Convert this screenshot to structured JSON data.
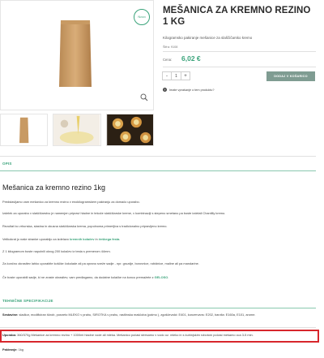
{
  "product": {
    "title": "MEŠANICA ZA KREMNO REZINO 1 KG",
    "subtitle": "Kilogramsko pakiranje mešanice za slaščičarsko kremo",
    "sku": "Šifra: 9108",
    "price_label": "Cena:",
    "price": "6,02 €",
    "quantity": "1",
    "minus": "-",
    "plus": "+",
    "add_to_cart": "DODAJ V KOŠARICO",
    "question": "Imate vprašanje o tem produktu?",
    "badge": "Novo"
  },
  "sections": {
    "desc_head": "OPIS",
    "desc_title": "Mešanica za kremno rezino 1kg",
    "p1": "Predstavljamo vam mešanico za kremno rezino v enokilogramskem pakiranju za domačo uporabo.",
    "p2": "Izdelek za uporabo v slaščičarstvu je namenjen pripravi hladne in tekoče slaščičarske kreme, v kombinaciji s stepeno smetano pa boste izdelali Chantilly kremo.",
    "p3": "Rezultat bo vrhunska, slastna in okusna slaščičarska krema, popolnoma primerljiva s tradicionalno pripravljeno kremo.",
    "p4a": "Velikokrat jo naše stranke uporabijo za izdelavo ",
    "p4_link1": "kremnih kolačev",
    "p4b": " in ",
    "p4_link2": "češkega festa",
    "p4c": ".",
    "p5": "Z 1 kilogramom boste napolnili okrog 200 kolačev iz testa s premerom 44mm.",
    "p6": "Za končno okrasitev lahko uporabite koščke čokolade ali pa oprano sveže sadje - npr. grozdje, borovnice, robidnice, maline ali pa mandarine.",
    "p7a": "Če boste uporabili sadje, ki ne zraste okrasitev, vam predlagamo, da dodatne kolačke na koncu premažete z ",
    "p7_link": "GELOSO",
    "p7b": ".",
    "spec_head": "TEHNIČNE SPECIFIKACIJE",
    "spec1_label": "Sestavine:",
    "spec1": " sladkor, modificiran škrob, posneto MLEKO v prahu, SIROTKA v prahu, rastlinska maščoba (palmo ), zgoščevalci: E401, konzervans: E202, barvila: E160a, E101, arome.",
    "spec2_label": "Uporaba:",
    "spec2": " 360/370g Mešanice za kremno rezino + 1000ml hladne vode ali mleka. Mešanico počasi stresamo v vodo oz. mleko in s kuhinjskim robotom počasi mešamo cca 3-5 min.",
    "spec3_label": "Pakiranje:",
    "spec3": " 1kg"
  },
  "colors": {
    "accent": "#3aa37a",
    "button": "#7f9c92",
    "highlight": "#d7262c"
  }
}
